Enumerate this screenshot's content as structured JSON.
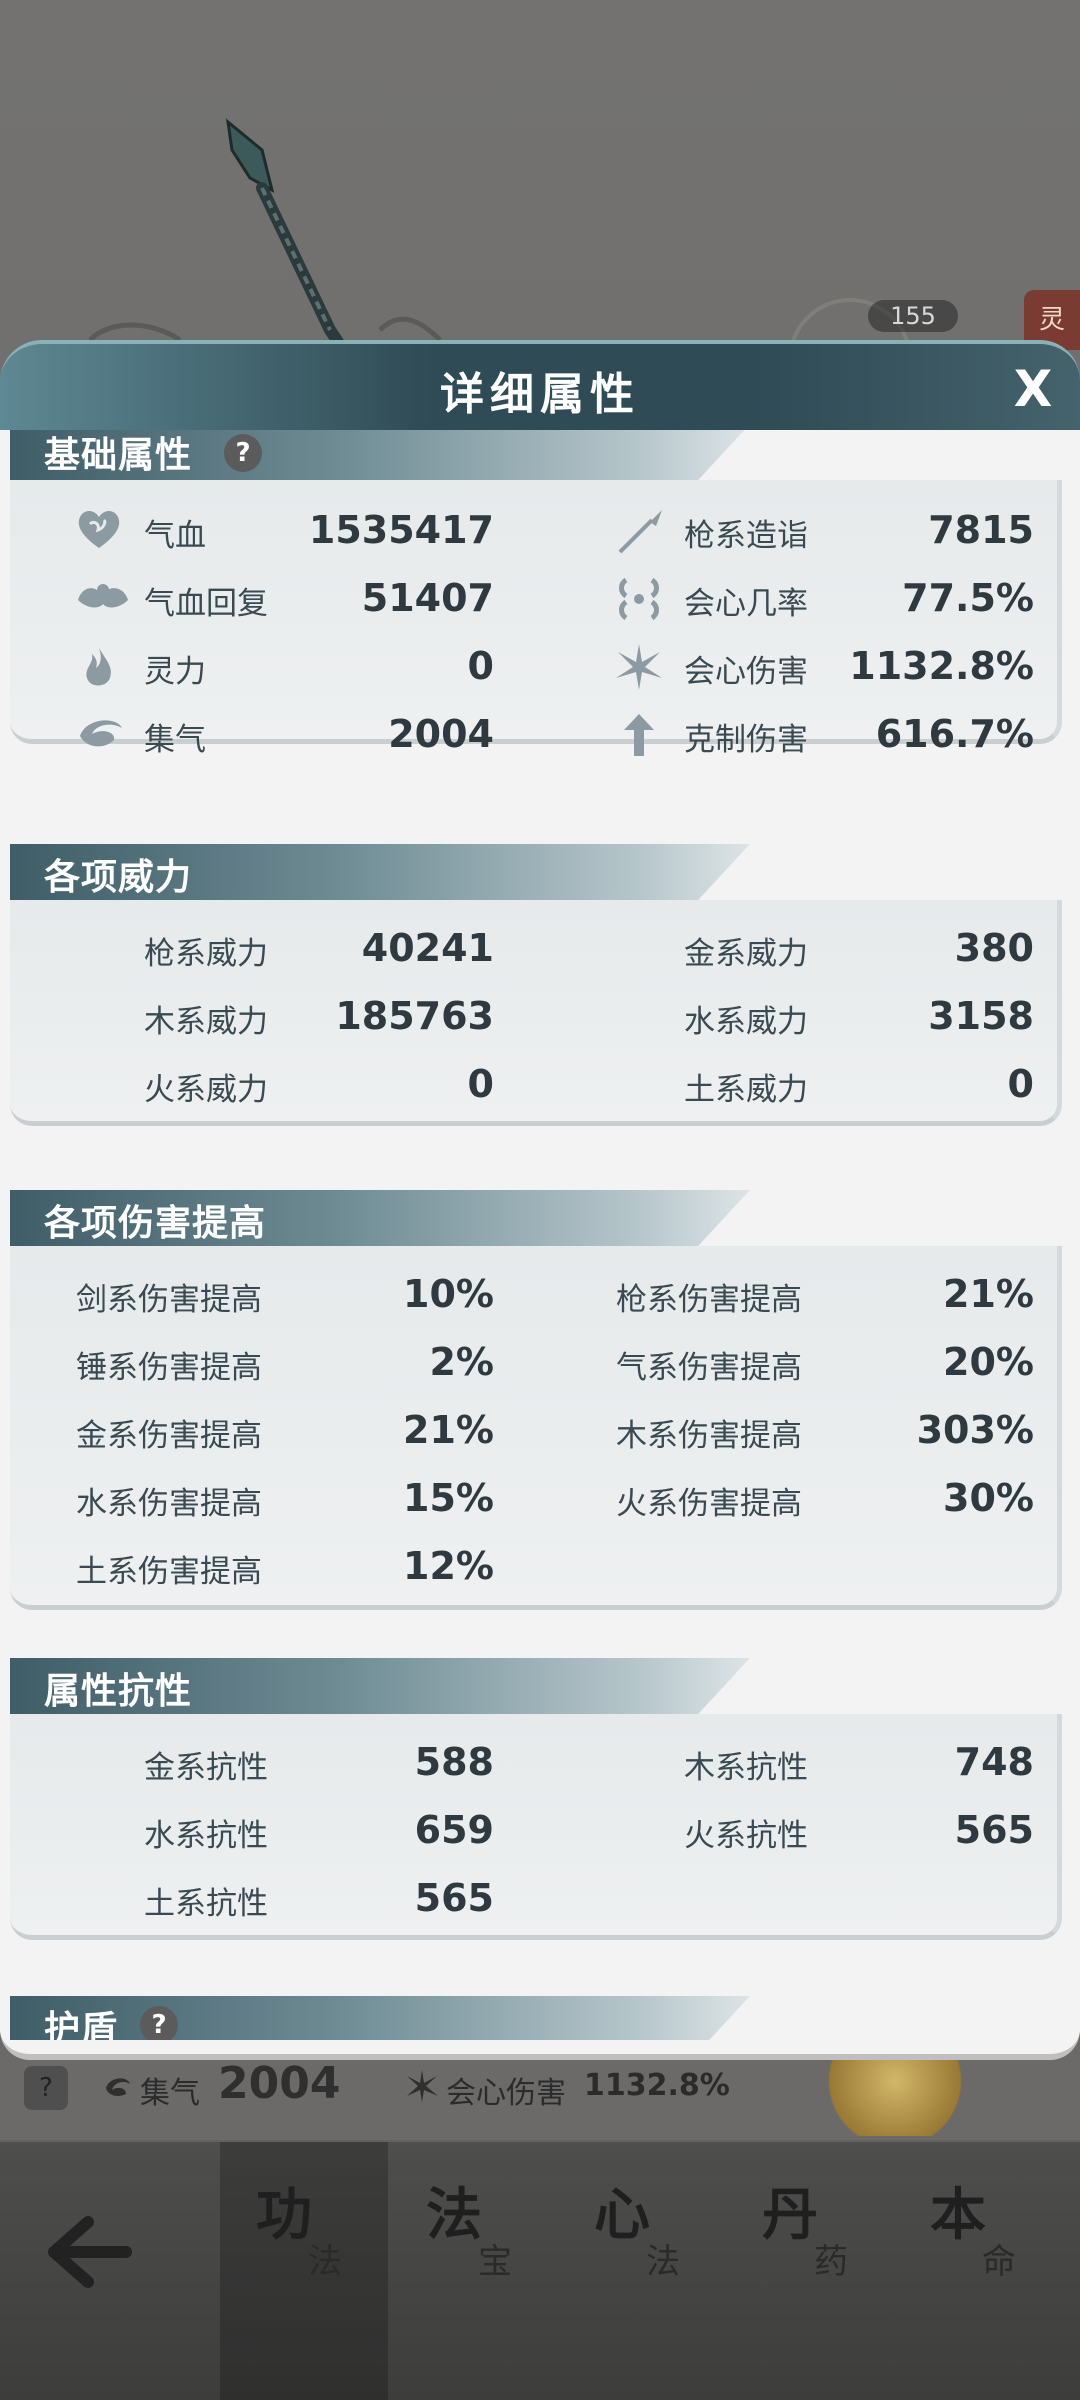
{
  "background": {
    "level_badge": "155",
    "side_tag": "灵",
    "strip": {
      "help": "?",
      "item1_label": "集气",
      "item1_value": "2004",
      "item2_label": "会心伤害",
      "item2_value": "1132.8%"
    }
  },
  "bottom_nav": {
    "tabs": [
      {
        "big": "功",
        "small": "法"
      },
      {
        "big": "法",
        "small": "宝"
      },
      {
        "big": "心",
        "small": "法"
      },
      {
        "big": "丹",
        "small": "药"
      },
      {
        "big": "本",
        "small": "命"
      }
    ]
  },
  "dialog": {
    "title": "详细属性",
    "close": "X",
    "help_mark": "?",
    "basic": {
      "title": "基础属性",
      "left": [
        {
          "icon": "heart-icon",
          "label": "气血",
          "value": "1535417"
        },
        {
          "icon": "heart-regen-icon",
          "label": "气血回复",
          "value": "51407"
        },
        {
          "icon": "spirit-drop-icon",
          "label": "灵力",
          "value": "0"
        },
        {
          "icon": "swirl-icon",
          "label": "集气",
          "value": "2004"
        }
      ],
      "right": [
        {
          "icon": "spear-icon",
          "label": "枪系造诣",
          "value": "7815"
        },
        {
          "icon": "crit-rate-icon",
          "label": "会心几率",
          "value": "77.5%"
        },
        {
          "icon": "crit-damage-icon",
          "label": "会心伤害",
          "value": "1132.8%"
        },
        {
          "icon": "counter-arrow-icon",
          "label": "克制伤害",
          "value": "616.7%"
        }
      ]
    },
    "power": {
      "title": "各项威力",
      "left": [
        {
          "label": "枪系威力",
          "value": "40241"
        },
        {
          "label": "木系威力",
          "value": "185763"
        },
        {
          "label": "火系威力",
          "value": "0"
        }
      ],
      "right": [
        {
          "label": "金系威力",
          "value": "380"
        },
        {
          "label": "水系威力",
          "value": "3158"
        },
        {
          "label": "土系威力",
          "value": "0"
        }
      ]
    },
    "damage": {
      "title": "各项伤害提高",
      "left": [
        {
          "label": "剑系伤害提高",
          "value": "10%"
        },
        {
          "label": "锤系伤害提高",
          "value": "2%"
        },
        {
          "label": "金系伤害提高",
          "value": "21%"
        },
        {
          "label": "水系伤害提高",
          "value": "15%"
        },
        {
          "label": "土系伤害提高",
          "value": "12%"
        }
      ],
      "right": [
        {
          "label": "枪系伤害提高",
          "value": "21%"
        },
        {
          "label": "气系伤害提高",
          "value": "20%"
        },
        {
          "label": "木系伤害提高",
          "value": "303%"
        },
        {
          "label": "火系伤害提高",
          "value": "30%"
        }
      ]
    },
    "resist": {
      "title": "属性抗性",
      "left": [
        {
          "label": "金系抗性",
          "value": "588"
        },
        {
          "label": "水系抗性",
          "value": "659"
        },
        {
          "label": "土系抗性",
          "value": "565"
        }
      ],
      "right": [
        {
          "label": "木系抗性",
          "value": "748"
        },
        {
          "label": "火系抗性",
          "value": "565"
        }
      ]
    },
    "shield": {
      "title": "护盾"
    }
  }
}
